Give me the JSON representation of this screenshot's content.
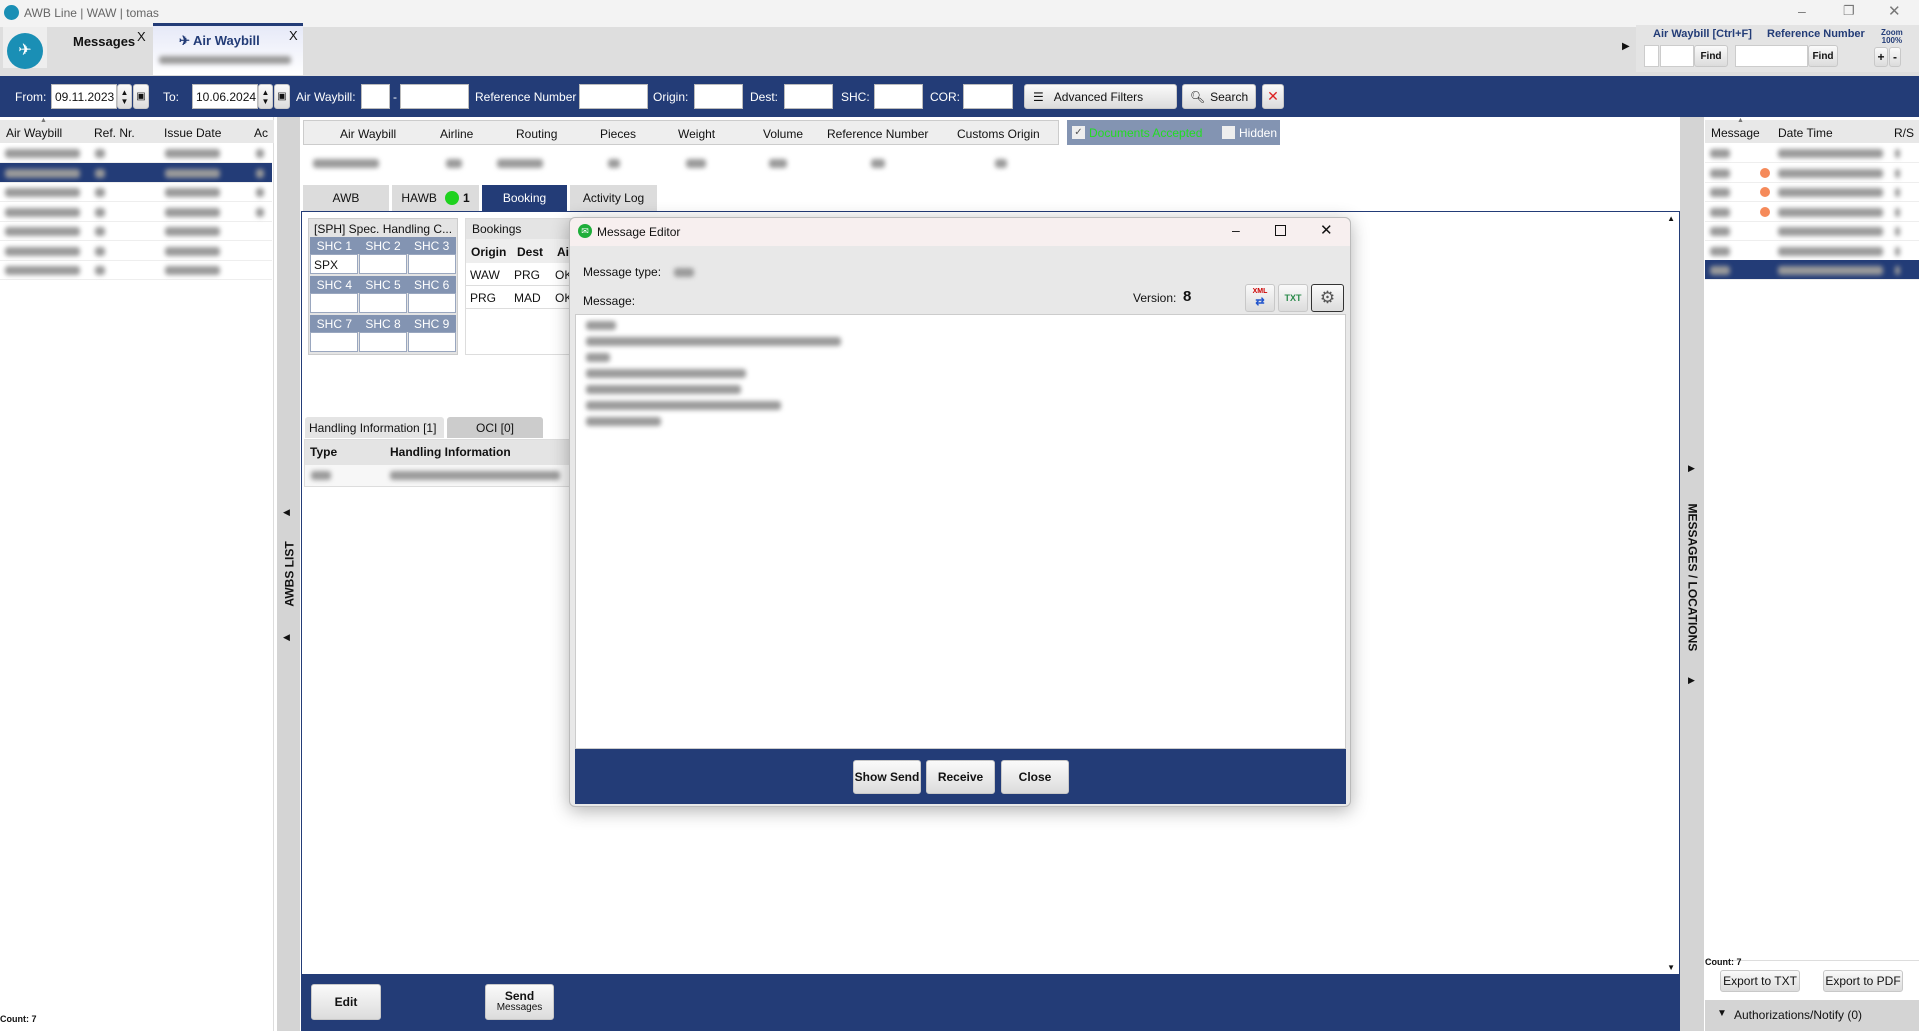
{
  "window": {
    "title": "AWB Line | WAW | tomas",
    "controls": [
      "minimize",
      "restore",
      "close"
    ]
  },
  "tabs": [
    {
      "label": "Messages",
      "close": "X"
    },
    {
      "label": "Air Waybill",
      "close": "X",
      "active": true
    }
  ],
  "quick_find": {
    "awb_label": "Air Waybill [Ctrl+F]",
    "ref_label": "Reference Number",
    "find": "Find",
    "zoom_label": "Zoom",
    "zoom_value": "100%",
    "plus": "+",
    "minus": "-"
  },
  "filters": {
    "from_label": "From:",
    "from_value": "09.11.2023",
    "to_label": "To:",
    "to_value": "10.06.2024",
    "awb_label": "Air Waybill:",
    "dash": "-",
    "ref_label": "Reference Number",
    "origin_label": "Origin:",
    "dest_label": "Dest:",
    "shc_label": "SHC:",
    "cor_label": "COR:",
    "advanced": "Advanced Filters",
    "search": "Search"
  },
  "awb_list": {
    "columns": [
      "Air Waybill",
      "Ref. Nr.",
      "Issue Date",
      "Ac"
    ],
    "selected_row": 2,
    "row_count": 7,
    "count": "Count: 7",
    "strip_label": "AWBS LIST"
  },
  "awb_header": {
    "columns": [
      "Air Waybill",
      "Airline",
      "Routing",
      "Pieces",
      "Weight",
      "Volume",
      "Reference Number",
      "Customs Origin"
    ],
    "documents_accepted": "Documents Accepted",
    "documents_accepted_checked": true,
    "hidden": "Hidden",
    "hidden_checked": false
  },
  "detail_tabs": [
    {
      "label": "AWB"
    },
    {
      "label": "HAWB",
      "badge": "1",
      "badge_color": "#1ed21e"
    },
    {
      "label": "Booking",
      "active": true
    },
    {
      "label": "Activity Log"
    }
  ],
  "shc": {
    "title": "[SPH] Spec. Handling C...",
    "headers": [
      [
        "SHC 1",
        "SHC 2",
        "SHC 3"
      ],
      [
        "SHC 4",
        "SHC 5",
        "SHC 6"
      ],
      [
        "SHC 7",
        "SHC 8",
        "SHC 9"
      ]
    ],
    "values": [
      [
        "SPX",
        "",
        ""
      ],
      [
        "",
        "",
        ""
      ],
      [
        "",
        "",
        ""
      ]
    ]
  },
  "bookings": {
    "title": "Bookings",
    "columns": [
      "Origin",
      "Dest",
      "Ai"
    ],
    "rows": [
      [
        "WAW",
        "PRG",
        "OK"
      ],
      [
        "PRG",
        "MAD",
        "OK"
      ]
    ]
  },
  "handling": {
    "tabs": [
      "Handling Information [1]",
      "OCI [0]"
    ],
    "columns": [
      "Type",
      "Handling Information"
    ]
  },
  "dialog": {
    "title": "Message Editor",
    "message_type_label": "Message type:",
    "message_label": "Message:",
    "version_label": "Version:",
    "version": "8",
    "icons": [
      "xml-export-icon",
      "txt-export-icon",
      "gear-icon"
    ],
    "buttons": [
      "Show Send",
      "Receive",
      "Close"
    ]
  },
  "bottom": {
    "edit": "Edit",
    "send": "Send",
    "send_sub": "Messages"
  },
  "messages": {
    "strip_label": "MESSAGES / LOCATIONS",
    "columns": [
      "Message",
      "Date Time",
      "R/S"
    ],
    "row_count": 7,
    "selected_row": 7,
    "alert_rows": [
      2,
      3,
      4
    ],
    "alert_color": "#f58a5a",
    "count": "Count: 7",
    "export_txt": "Export to TXT",
    "export_pdf": "Export to PDF",
    "authorizations": "Authorizations/Notify (0)"
  },
  "colors": {
    "brand": "#233c77",
    "accepted": "#22dd22"
  }
}
